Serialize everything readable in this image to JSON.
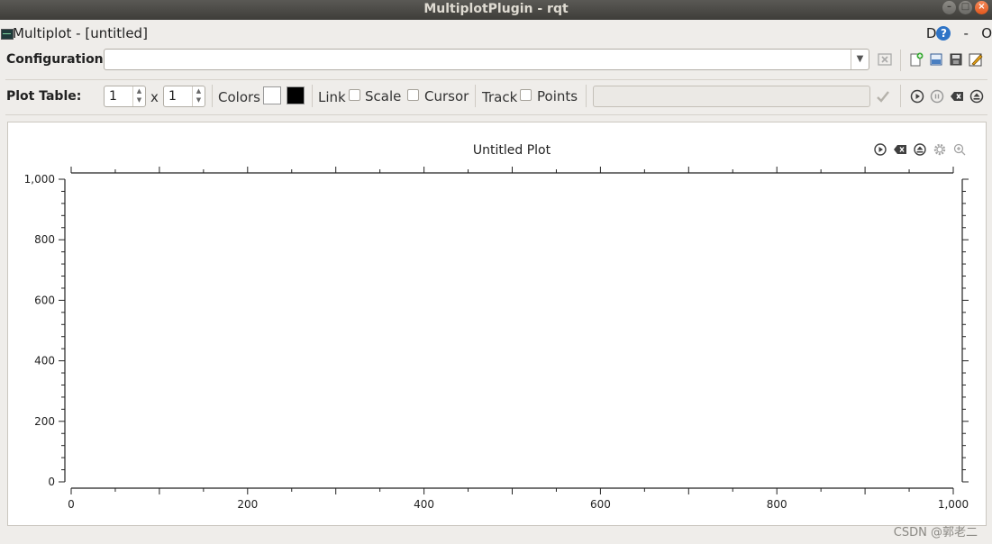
{
  "window": {
    "title": "MultiplotPlugin - rqt",
    "buttons": [
      "–",
      "□",
      "×"
    ]
  },
  "plugin": {
    "title": "Multiplot - [untitled]",
    "right_d": "D",
    "help": "?",
    "right_dash": "-",
    "right_o": "O"
  },
  "config": {
    "label": "Configuration:",
    "value": "",
    "icons": [
      "clear-icon",
      "new-config-icon",
      "open-config-icon",
      "save-config-icon",
      "edit-config-icon"
    ]
  },
  "plot_table": {
    "label": "Plot Table:",
    "rows": "1",
    "times": "x",
    "cols": "1",
    "colors_label": "Colors",
    "color_background": "#ffffff",
    "color_foreground": "#000000",
    "link_label": "Link",
    "scale_label": "Scale",
    "cursor_label": "Cursor",
    "track_label": "Track",
    "points_label": "Points",
    "icons": [
      "apply-check-icon",
      "play-icon",
      "pause-icon",
      "clear-icon",
      "export-icon"
    ]
  },
  "plot": {
    "title": "Untitled Plot",
    "icons": [
      "play-icon",
      "clear-icon",
      "export-icon",
      "settings-icon",
      "zoom-icon"
    ]
  },
  "chart_data": {
    "type": "line",
    "title": "Untitled Plot",
    "xlabel": "",
    "ylabel": "",
    "xlim": [
      0,
      1000
    ],
    "ylim": [
      0,
      1000
    ],
    "x_ticks": [
      "0",
      "200",
      "400",
      "600",
      "800",
      "1,000"
    ],
    "y_ticks": [
      "0",
      "200",
      "400",
      "600",
      "800",
      "1,000"
    ],
    "series": [],
    "grid": false
  },
  "watermark": "CSDN @郭老二"
}
